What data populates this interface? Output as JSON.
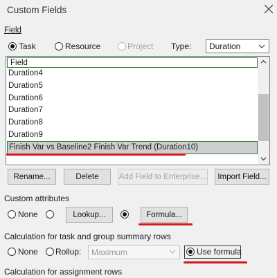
{
  "dialog": {
    "title": "Custom Fields"
  },
  "field_section": {
    "label": "Field",
    "type_options": [
      {
        "label": "Task",
        "selected": true,
        "enabled": true
      },
      {
        "label": "Resource",
        "selected": false,
        "enabled": true
      },
      {
        "label": "Project",
        "selected": false,
        "enabled": false
      }
    ],
    "type_label": "Type:",
    "type_value": "Duration"
  },
  "field_list": {
    "header": "Field",
    "rows": [
      "Duration4",
      "Duration5",
      "Duration6",
      "Duration7",
      "Duration8",
      "Duration9"
    ],
    "selected_row": "Finish Var vs Baseline2 Finish Var Trend (Duration10)"
  },
  "buttons": {
    "rename": "Rename...",
    "delete": "Delete",
    "add_enterprise": "Add Field to Enterprise...",
    "import": "Import Field..."
  },
  "custom_attributes": {
    "label": "Custom attributes",
    "none_label": "None",
    "lookup_label": "Lookup...",
    "formula_label": "Formula...",
    "selected": "formula"
  },
  "summary_rows": {
    "label": "Calculation for task and group summary rows",
    "none_label": "None",
    "rollup_label": "Rollup:",
    "rollup_value": "Maximum",
    "use_formula_label": "Use formula",
    "selected": "use_formula"
  },
  "assignment_rows": {
    "label": "Calculation for assignment rows"
  },
  "colors": {
    "highlight_green": "#2e7d32",
    "underline_red": "#d2171e",
    "selected_row_bg": "#cfcfcf"
  }
}
